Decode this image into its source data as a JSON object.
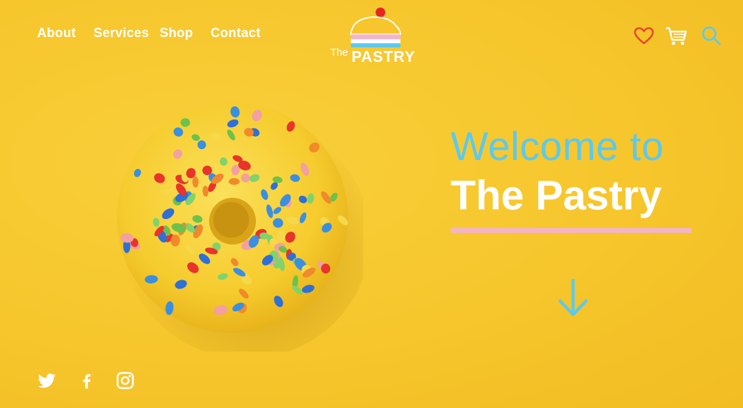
{
  "nav": {
    "items": [
      "About",
      "Services",
      "Shop",
      "Contact"
    ]
  },
  "logo": {
    "prefix": "The",
    "name": "PASTRY"
  },
  "header_icons": [
    "heart-icon",
    "cart-icon",
    "search-icon"
  ],
  "hero": {
    "welcome": "Welcome to",
    "title": "The Pastry"
  },
  "social": [
    "twitter-icon",
    "facebook-icon",
    "instagram-icon"
  ],
  "colors": {
    "background": "#f6c62c",
    "accent_blue": "#5cc9ee",
    "accent_pink": "#f5b4c8",
    "heart_red": "#e8452f",
    "text_white": "#ffffff"
  }
}
